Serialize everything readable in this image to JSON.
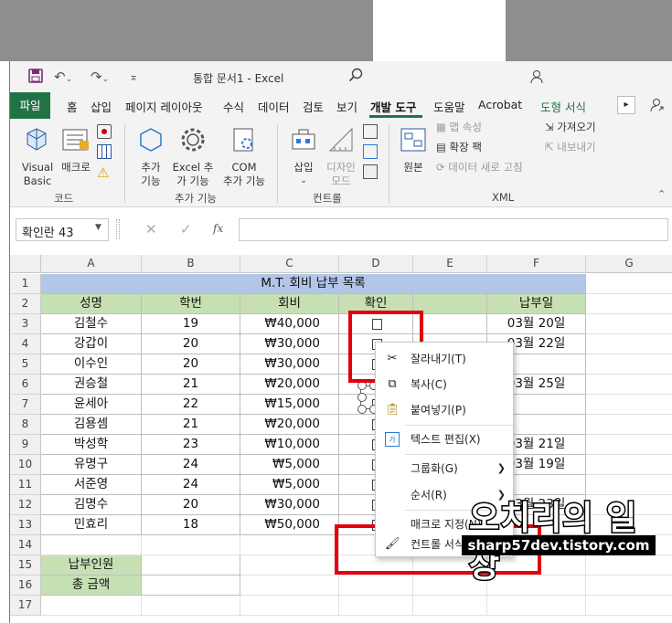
{
  "window": {
    "title": "통합 문서1  -  Excel"
  },
  "tabs": {
    "file": "파일",
    "home": "홈",
    "insert": "삽입",
    "page_layout": "페이지 레이아웃",
    "formulas": "수식",
    "data": "데이터",
    "review": "검토",
    "view": "보기",
    "developer": "개발 도구",
    "help": "도움말",
    "acrobat": "Acrobat",
    "shape_format": "도형 서식"
  },
  "ribbon": {
    "code_group": "코드",
    "visual_basic_1": "Visual",
    "visual_basic_2": "Basic",
    "macros": "매크로",
    "addins_group": "추가 기능",
    "addins_1": "추가",
    "addins_2": "기능",
    "excel_addins_1": "Excel 추",
    "excel_addins_2": "가 기능",
    "com_addins_1": "COM",
    "com_addins_2": "추가 기능",
    "controls_group": "컨트롤",
    "insert_ctrl": "삽입",
    "design_mode_1": "디자인",
    "design_mode_2": "모드",
    "xml_group": "XML",
    "source": "원본",
    "map_props": "맵 속성",
    "expansion_packs": "확장 팩",
    "refresh_data": "데이터 새로 고침",
    "import": "가져오기",
    "export": "내보내기"
  },
  "formula_bar": {
    "name_box": "확인란 43",
    "fx": "fx",
    "formula": ""
  },
  "columns": [
    "A",
    "B",
    "C",
    "D",
    "E",
    "F",
    "G"
  ],
  "rows": [
    "1",
    "2",
    "3",
    "4",
    "5",
    "6",
    "7",
    "8",
    "9",
    "10",
    "11",
    "12",
    "13",
    "14",
    "15",
    "16",
    "17"
  ],
  "sheet": {
    "title": "M.T. 회비 납부 목록",
    "headers": {
      "name": "성명",
      "id": "학번",
      "fee": "회비",
      "check": "확인",
      "date": "납부일"
    },
    "records": [
      {
        "name": "김철수",
        "id": "19",
        "fee": "₩40,000",
        "date": "03월 20일"
      },
      {
        "name": "강갑이",
        "id": "20",
        "fee": "₩30,000",
        "date": "03월 22일"
      },
      {
        "name": "이수인",
        "id": "20",
        "fee": "₩30,000",
        "date": ""
      },
      {
        "name": "권승철",
        "id": "21",
        "fee": "₩20,000",
        "date": "03월 25일"
      },
      {
        "name": "윤세아",
        "id": "22",
        "fee": "₩15,000",
        "date": ""
      },
      {
        "name": "김용셈",
        "id": "21",
        "fee": "₩20,000",
        "date": ""
      },
      {
        "name": "박성학",
        "id": "23",
        "fee": "₩10,000",
        "date": "03월 21일"
      },
      {
        "name": "유명구",
        "id": "24",
        "fee": "₩5,000",
        "date": "03월 19일"
      },
      {
        "name": "서준영",
        "id": "24",
        "fee": "₩5,000",
        "date": ""
      },
      {
        "name": "김명수",
        "id": "20",
        "fee": "₩30,000",
        "date": "03월 23일"
      },
      {
        "name": "민효리",
        "id": "18",
        "fee": "₩50,000",
        "date": ""
      }
    ],
    "paid_count_label": "납부인원",
    "total_label": "총 금액"
  },
  "context_menu": {
    "cut": "잘라내기(T)",
    "copy": "복사(C)",
    "paste": "붙여넣기(P)",
    "edit_text": "텍스트 편집(X)",
    "group": "그룹화(G)",
    "order": "순서(R)",
    "assign_macro": "매크로 지정(N)...",
    "format_control": "컨트롤 서식(F)..."
  },
  "watermark": {
    "title": "오치리의 일상",
    "url": "sharp57dev.tistory.com"
  },
  "colors": {
    "excel_green": "#217346",
    "title_blue": "#b4c6e7",
    "header_green": "#c6e0b4",
    "highlight_red": "#e0000e"
  }
}
